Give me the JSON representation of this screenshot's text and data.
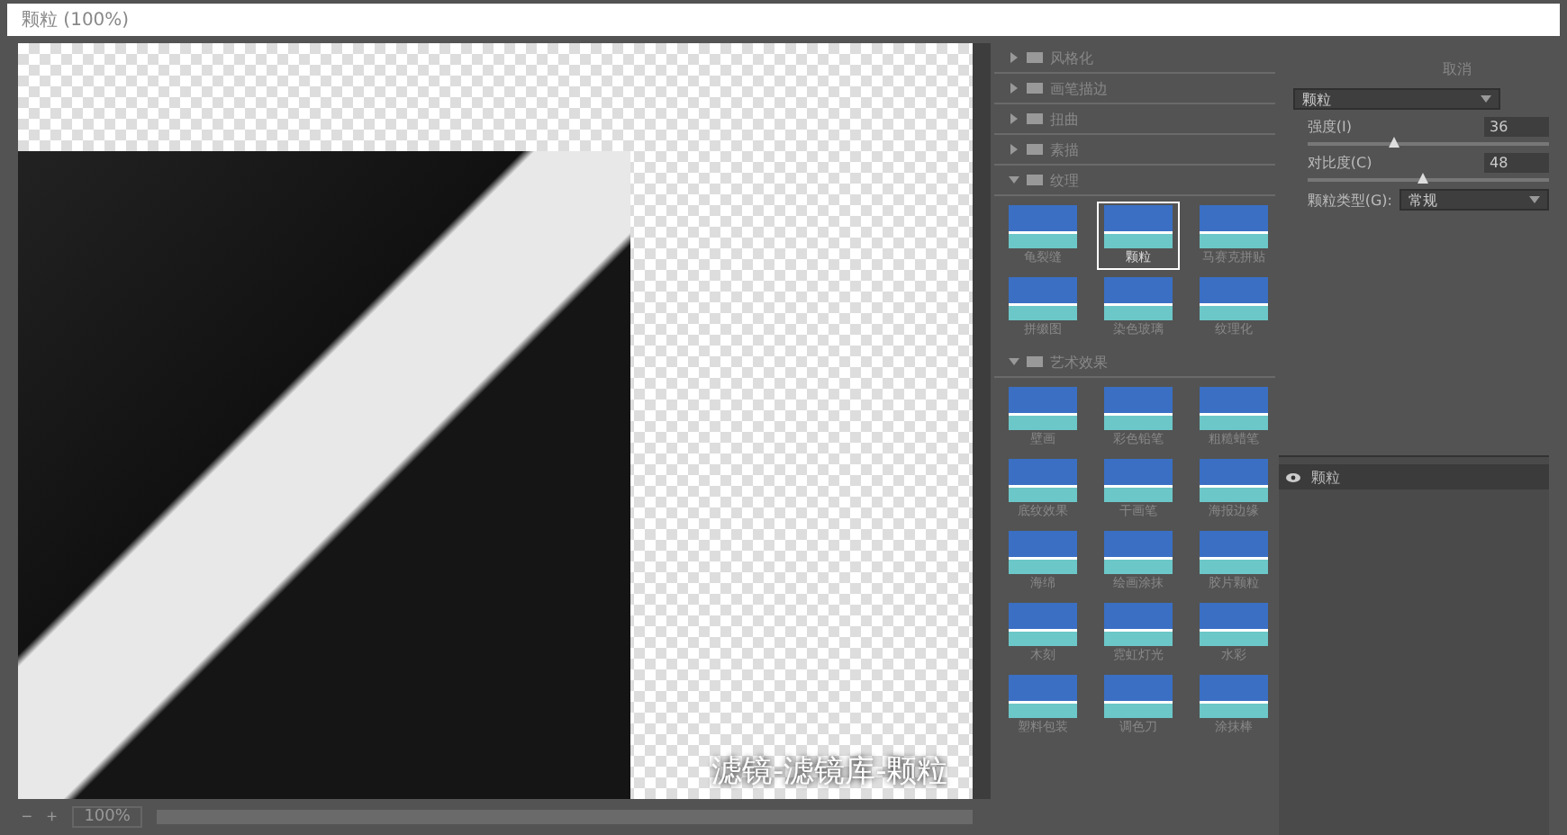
{
  "window": {
    "title": "颗粒 (100%)"
  },
  "preview": {
    "caption": "滤镜-滤镜库-颗粒",
    "zoom": "100%",
    "zoom_out": "−",
    "zoom_in": "+"
  },
  "gallery": [
    {
      "name": "风格化",
      "expanded": false
    },
    {
      "name": "画笔描边",
      "expanded": false
    },
    {
      "name": "扭曲",
      "expanded": false
    },
    {
      "name": "素描",
      "expanded": false
    },
    {
      "name": "纹理",
      "expanded": true,
      "filters": [
        {
          "name": "龟裂缝",
          "selected": false
        },
        {
          "name": "颗粒",
          "selected": true
        },
        {
          "name": "马赛克拼贴",
          "selected": false
        },
        {
          "name": "拼缀图",
          "selected": false
        },
        {
          "name": "染色玻璃",
          "selected": false
        },
        {
          "name": "纹理化",
          "selected": false
        }
      ]
    },
    {
      "name": "艺术效果",
      "expanded": true,
      "filters": [
        {
          "name": "壁画",
          "selected": false
        },
        {
          "name": "彩色铅笔",
          "selected": false
        },
        {
          "name": "粗糙蜡笔",
          "selected": false
        },
        {
          "name": "底纹效果",
          "selected": false
        },
        {
          "name": "干画笔",
          "selected": false
        },
        {
          "name": "海报边缘",
          "selected": false
        },
        {
          "name": "海绵",
          "selected": false
        },
        {
          "name": "绘画涂抹",
          "selected": false
        },
        {
          "name": "胶片颗粒",
          "selected": false
        },
        {
          "name": "木刻",
          "selected": false
        },
        {
          "name": "霓虹灯光",
          "selected": false
        },
        {
          "name": "水彩",
          "selected": false
        },
        {
          "name": "塑料包装",
          "selected": false
        },
        {
          "name": "调色刀",
          "selected": false
        },
        {
          "name": "涂抹棒",
          "selected": false
        }
      ]
    }
  ],
  "settings": {
    "cancel": "取消",
    "filter": "颗粒",
    "params": [
      {
        "label": "强度(I)",
        "value": "36",
        "level": 0.36
      },
      {
        "label": "对比度(C)",
        "value": "48",
        "level": 0.48
      }
    ],
    "type_label": "颗粒类型(G):",
    "type_value": "常规"
  },
  "layers": [
    {
      "name": "颗粒",
      "visible": true
    }
  ]
}
